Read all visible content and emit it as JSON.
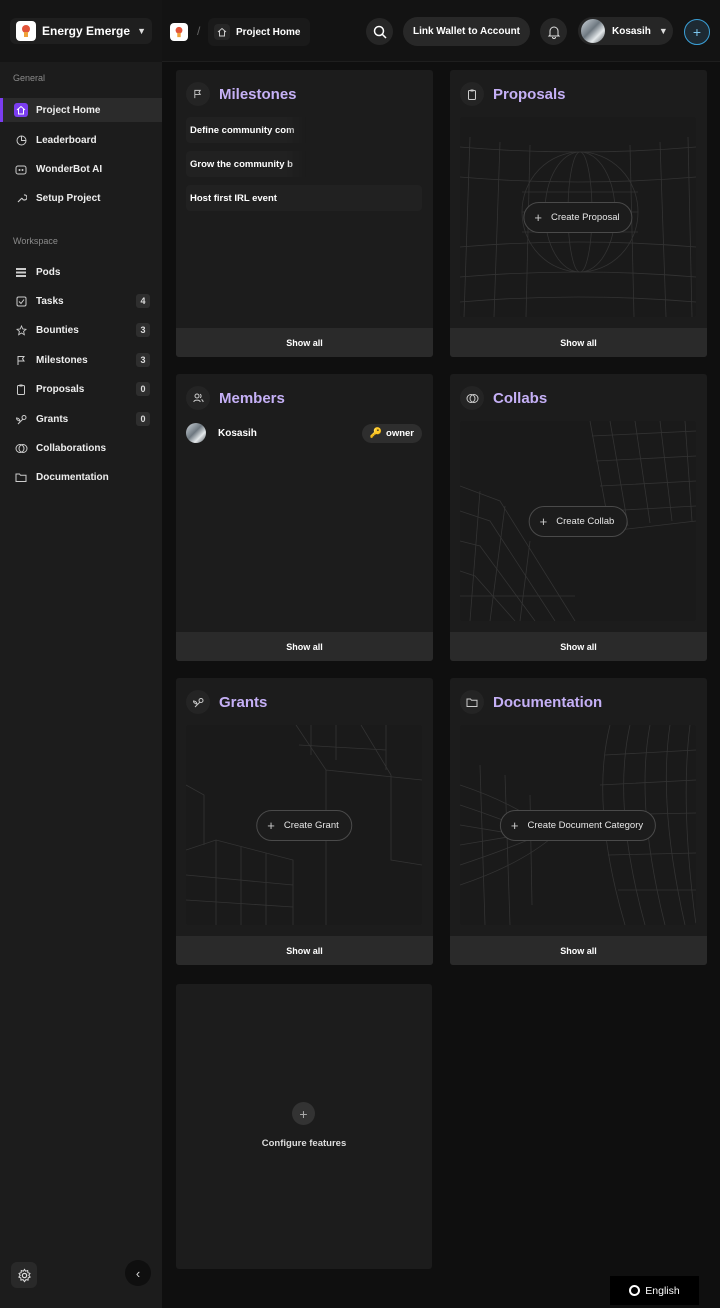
{
  "header": {
    "org_name": "Energy Emerge F...",
    "breadcrumb_page": "Project Home",
    "wallet_button": "Link Wallet to Account",
    "user_name": "Kosasih",
    "icons": {
      "search": "search-icon",
      "bell": "bell-icon",
      "add": "plus-icon"
    }
  },
  "sidebar": {
    "general_title": "General",
    "general_items": [
      {
        "label": "Project Home",
        "icon": "home-icon",
        "active": true
      },
      {
        "label": "Leaderboard",
        "icon": "chart-icon"
      },
      {
        "label": "WonderBot AI",
        "icon": "bot-icon"
      },
      {
        "label": "Setup Project",
        "icon": "wrench-icon"
      }
    ],
    "workspace_title": "Workspace",
    "workspace_items": [
      {
        "label": "Pods",
        "icon": "stack-icon",
        "count": ""
      },
      {
        "label": "Tasks",
        "icon": "checkbox-icon",
        "count": "4"
      },
      {
        "label": "Bounties",
        "icon": "star-icon",
        "count": "3"
      },
      {
        "label": "Milestones",
        "icon": "flag-icon",
        "count": "3"
      },
      {
        "label": "Proposals",
        "icon": "clipboard-icon",
        "count": "0"
      },
      {
        "label": "Grants",
        "icon": "sprout-icon",
        "count": "0"
      },
      {
        "label": "Collaborations",
        "icon": "collab-icon",
        "count": ""
      },
      {
        "label": "Documentation",
        "icon": "folder-icon",
        "count": ""
      }
    ]
  },
  "cards": {
    "milestones": {
      "title": "Milestones",
      "items": [
        "Define community com",
        "Grow the community b",
        "Host first IRL event"
      ],
      "footer": "Show all"
    },
    "proposals": {
      "title": "Proposals",
      "create_label": "Create Proposal",
      "footer": "Show all"
    },
    "members": {
      "title": "Members",
      "member_name": "Kosasih",
      "role": "owner",
      "footer": "Show all"
    },
    "collabs": {
      "title": "Collabs",
      "create_label": "Create Collab",
      "footer": "Show all"
    },
    "grants": {
      "title": "Grants",
      "create_label": "Create Grant",
      "footer": "Show all"
    },
    "documentation": {
      "title": "Documentation",
      "create_label": "Create Document Category",
      "footer": "Show all"
    },
    "configure": {
      "label": "Configure features"
    }
  },
  "language": "English",
  "colors": {
    "accent": "#7b3df0",
    "card_title": "#c5b0f6",
    "add_ring": "#3aa0d8"
  }
}
